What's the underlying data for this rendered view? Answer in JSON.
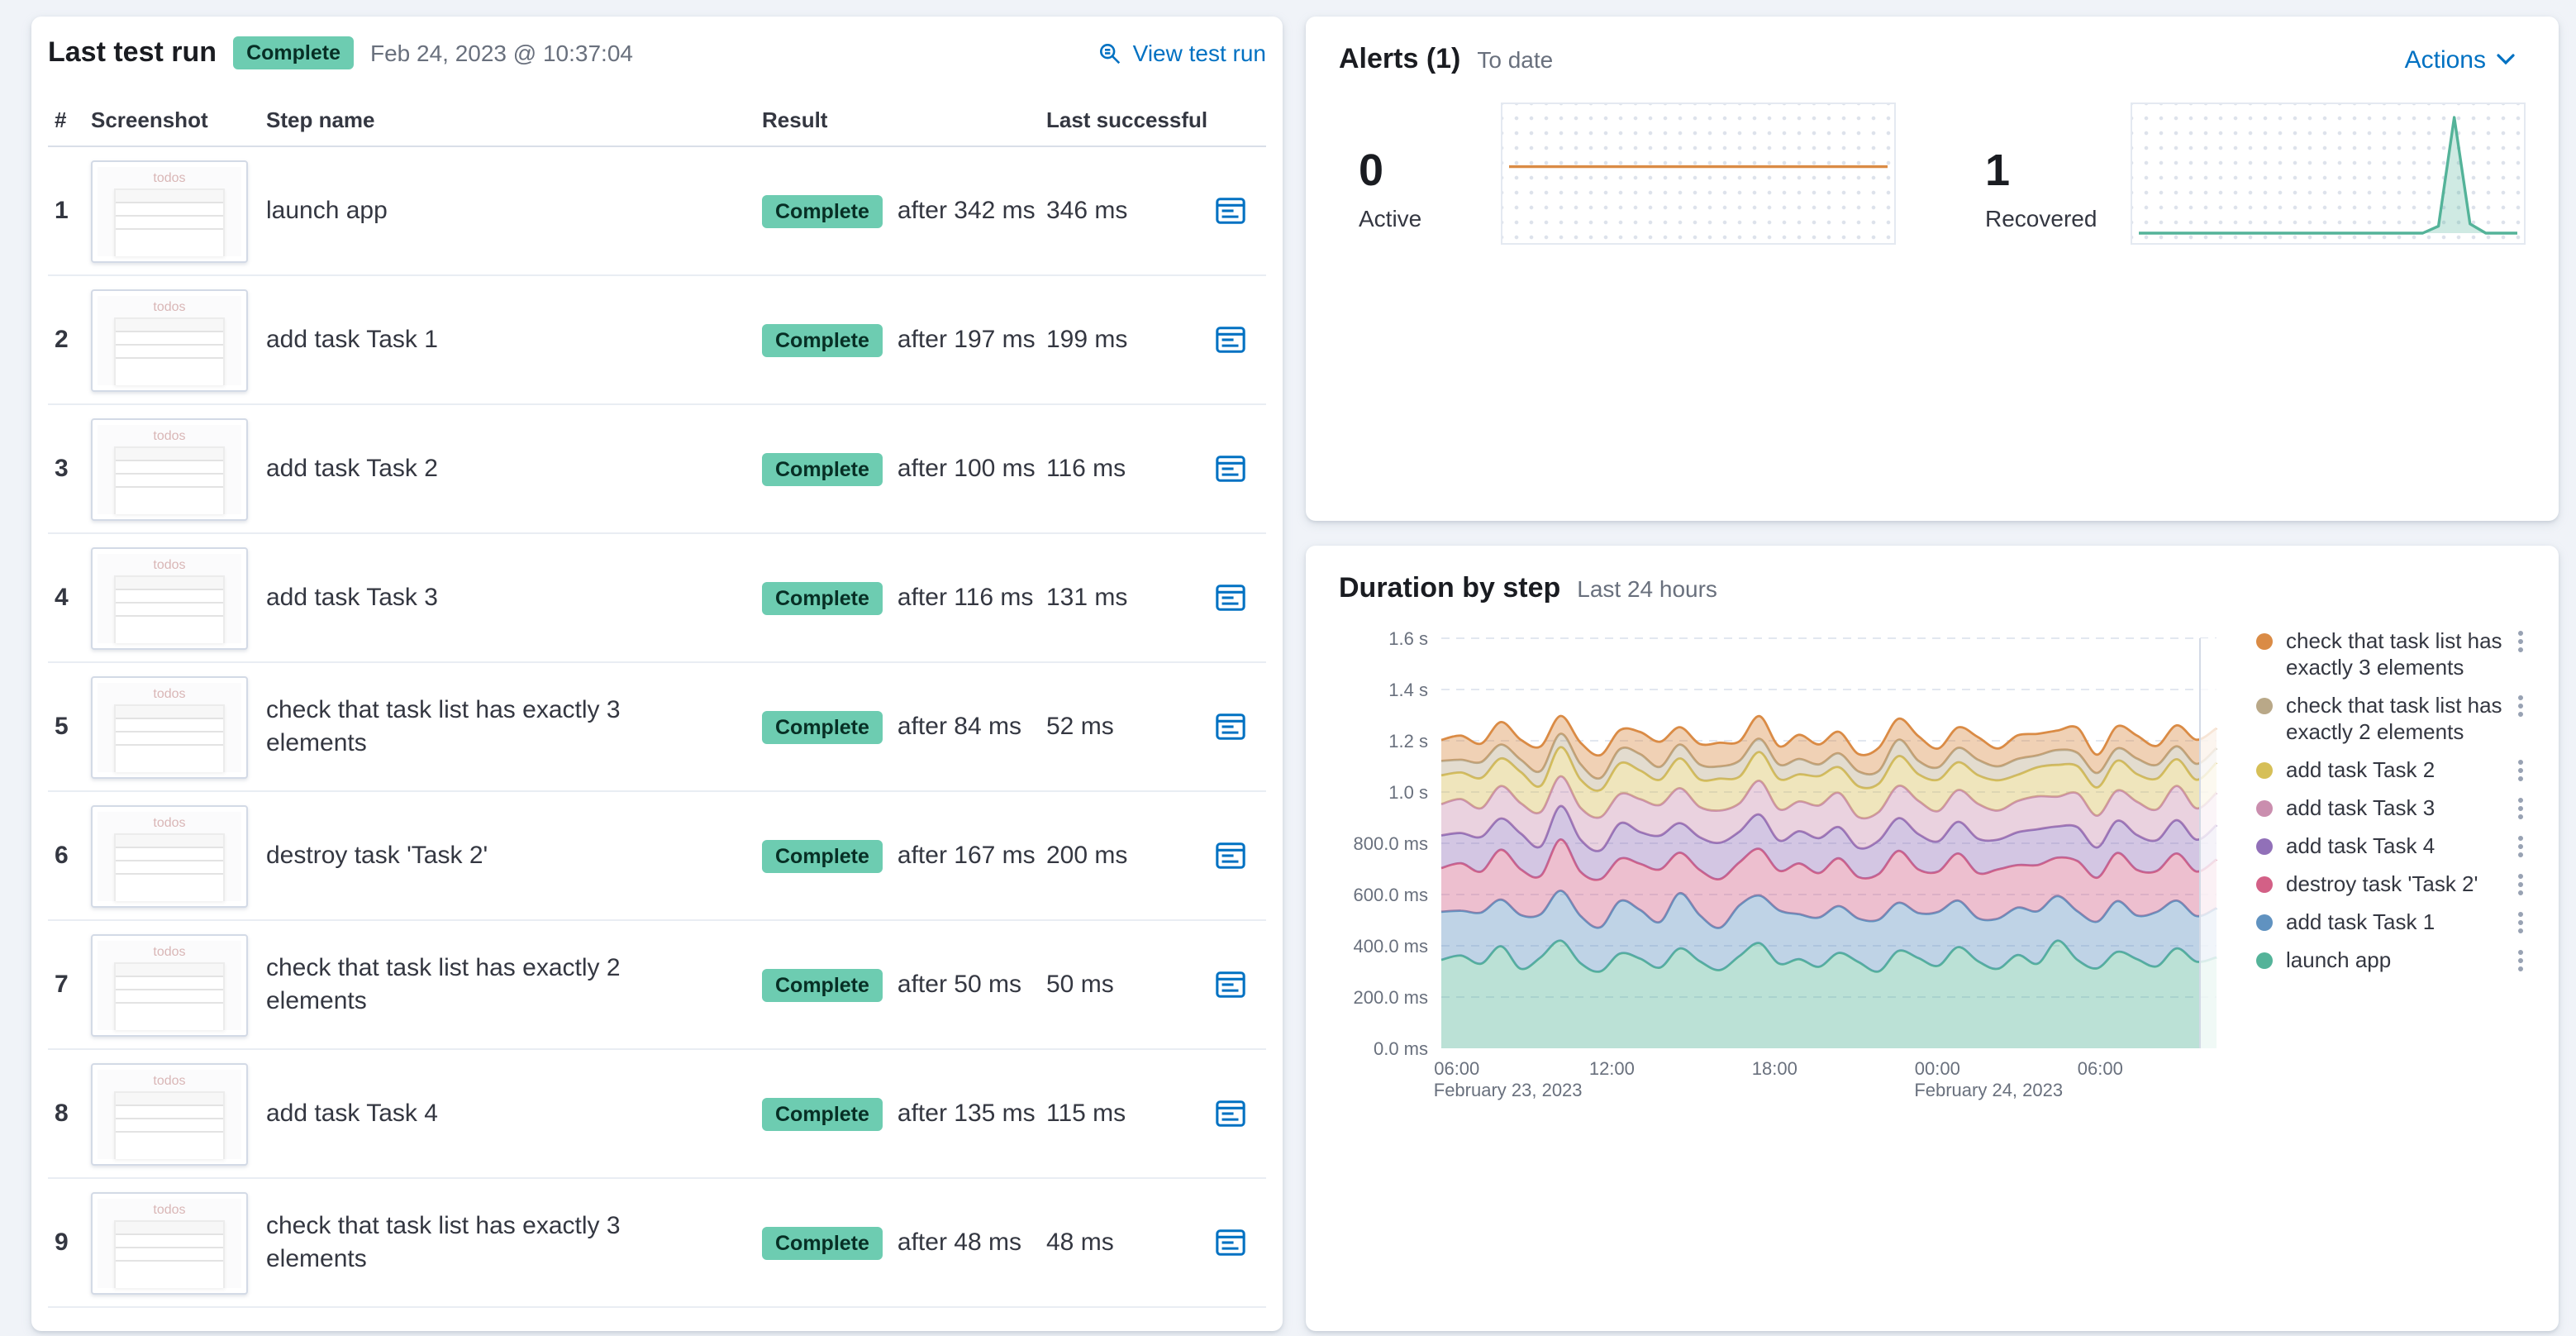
{
  "last_test_run": {
    "title": "Last test run",
    "status_badge": "Complete",
    "timestamp": "Feb 24, 2023 @ 10:37:04",
    "view_link": "View test run",
    "columns": [
      "#",
      "Screenshot",
      "Step name",
      "Result",
      "Last successful"
    ],
    "thumbnail_label": "todos",
    "steps": [
      {
        "num": "1",
        "name": "launch app",
        "result": "Complete",
        "after": "after 342 ms",
        "last": "346 ms"
      },
      {
        "num": "2",
        "name": "add task Task 1",
        "result": "Complete",
        "after": "after 197 ms",
        "last": "199 ms"
      },
      {
        "num": "3",
        "name": "add task Task 2",
        "result": "Complete",
        "after": "after 100 ms",
        "last": "116 ms"
      },
      {
        "num": "4",
        "name": "add task Task 3",
        "result": "Complete",
        "after": "after 116 ms",
        "last": "131 ms"
      },
      {
        "num": "5",
        "name": "check that task list has exactly 3 elements",
        "result": "Complete",
        "after": "after 84 ms",
        "last": "52 ms"
      },
      {
        "num": "6",
        "name": "destroy task 'Task 2'",
        "result": "Complete",
        "after": "after 167 ms",
        "last": "200 ms"
      },
      {
        "num": "7",
        "name": "check that task list has exactly 2 elements",
        "result": "Complete",
        "after": "after 50 ms",
        "last": "50 ms"
      },
      {
        "num": "8",
        "name": "add task Task 4",
        "result": "Complete",
        "after": "after 135 ms",
        "last": "115 ms"
      },
      {
        "num": "9",
        "name": "check that task list has exactly 3 elements",
        "result": "Complete",
        "after": "after 48 ms",
        "last": "48 ms"
      }
    ]
  },
  "alerts": {
    "title": "Alerts (1)",
    "subtitle": "To date",
    "actions_label": "Actions",
    "stats": [
      {
        "value": "0",
        "label": "Active"
      },
      {
        "value": "1",
        "label": "Recovered"
      }
    ]
  },
  "duration_panel": {
    "title": "Duration by step",
    "subtitle": "Last 24 hours"
  },
  "colors": {
    "page_bg": "#F0F3F8",
    "link": "#0071C2",
    "success_badge_bg": "#6DCCB1",
    "active_alert_line": "#DA8B45",
    "recovered_alert_line": "#54B399"
  },
  "chart_data": [
    {
      "type": "line",
      "name": "Active alerts sparkline",
      "color": "#DA8B45",
      "ylim": [
        0,
        1
      ],
      "flat_y_frac": 0.45,
      "values": [
        0,
        0,
        0,
        0,
        0,
        0,
        0,
        0,
        0,
        0,
        0,
        0,
        0,
        0,
        0,
        0,
        0,
        0,
        0,
        0,
        0,
        0,
        0,
        0,
        0
      ]
    },
    {
      "type": "area",
      "name": "Recovered alerts sparkline",
      "color": "#54B399",
      "fill": "rgba(84,179,153,0.28)",
      "ylim": [
        0,
        1
      ],
      "values": [
        0,
        0,
        0,
        0,
        0,
        0,
        0,
        0,
        0,
        0,
        0,
        0,
        0,
        0,
        0,
        0,
        0,
        0,
        0,
        0.06,
        1,
        0.08,
        0,
        0,
        0
      ]
    },
    {
      "type": "area",
      "stacked": true,
      "title": "Duration by step",
      "subtitle": "Last 24 hours",
      "ylabel": "",
      "xlabel": "",
      "ylim_ms": [
        0,
        1600
      ],
      "y_ticks": [
        "0.0 ms",
        "200.0 ms",
        "400.0 ms",
        "600.0 ms",
        "800.0 ms",
        "1.0 s",
        "1.2 s",
        "1.4 s",
        "1.6 s"
      ],
      "x_ticks": [
        {
          "label": "06:00",
          "frac": 0.02
        },
        {
          "label": "12:00",
          "frac": 0.22
        },
        {
          "label": "18:00",
          "frac": 0.43
        },
        {
          "label": "00:00",
          "frac": 0.64
        },
        {
          "label": "06:00",
          "frac": 0.85
        }
      ],
      "x_date_labels": [
        {
          "label": "February 23, 2023",
          "frac": 0.02
        },
        {
          "label": "February 24, 2023",
          "frac": 0.64
        }
      ],
      "series": [
        {
          "name": "launch app",
          "color": "#54B399",
          "values": [
            345,
            362,
            330,
            398,
            310,
            355,
            420,
            332,
            300,
            370,
            350,
            315,
            390,
            340,
            305,
            360,
            410,
            330,
            348,
            318,
            372,
            336,
            300,
            380,
            352,
            322,
            395,
            340,
            310,
            364,
            330,
            420,
            345,
            312,
            376,
            348,
            320,
            390,
            338,
            355
          ]
        },
        {
          "name": "add task Task 1",
          "color": "#6092C0",
          "values": [
            188,
            175,
            200,
            182,
            210,
            168,
            195,
            185,
            172,
            205,
            190,
            178,
            215,
            180,
            165,
            198,
            186,
            208,
            175,
            192,
            183,
            170,
            202,
            188,
            176,
            210,
            181,
            168,
            196,
            185,
            205,
            174,
            190,
            182,
            198,
            170,
            212,
            186,
            178,
            192
          ]
        },
        {
          "name": "destroy task 'Task 2'",
          "color": "#D36086",
          "values": [
            170,
            185,
            160,
            195,
            178,
            150,
            200,
            172,
            188,
            165,
            180,
            205,
            158,
            176,
            190,
            168,
            182,
            155,
            198,
            174,
            186,
            162,
            178,
            202,
            170,
            158,
            184,
            176,
            192,
            166,
            180,
            150,
            196,
            172,
            188,
            178,
            160,
            184,
            174,
            190
          ]
        },
        {
          "name": "add task Task 4",
          "color": "#9170B8",
          "values": [
            128,
            118,
            135,
            122,
            140,
            115,
            130,
            126,
            112,
            138,
            124,
            132,
            116,
            128,
            142,
            120,
            134,
            118,
            126,
            136,
            122,
            114,
            130,
            128,
            138,
            118,
            124,
            134,
            116,
            128,
            140,
            122,
            132,
            118,
            126,
            136,
            120,
            130,
            124,
            134
          ]
        },
        {
          "name": "add task Task 3",
          "color": "#CA8EAE",
          "values": [
            122,
            132,
            112,
            126,
            118,
            134,
            116,
            124,
            130,
            114,
            128,
            120,
            136,
            118,
            126,
            110,
            132,
            122,
            116,
            128,
            134,
            120,
            112,
            126,
            130,
            118,
            124,
            136,
            114,
            122,
            128,
            116,
            132,
            124,
            118,
            130,
            120,
            134,
            122,
            126
          ]
        },
        {
          "name": "add task Task 2",
          "color": "#D6BF57",
          "values": [
            112,
            104,
            118,
            108,
            122,
            102,
            114,
            110,
            106,
            120,
            112,
            98,
            116,
            108,
            124,
            104,
            112,
            118,
            106,
            114,
            100,
            120,
            110,
            116,
            104,
            122,
            108,
            112,
            118,
            102,
            114,
            124,
            106,
            110,
            116,
            108,
            120,
            104,
            112,
            118
          ]
        },
        {
          "name": "check that task list has exactly 2 elements",
          "color": "#B9A888",
          "values": [
            56,
            50,
            62,
            54,
            48,
            58,
            52,
            60,
            46,
            56,
            64,
            50,
            54,
            58,
            48,
            62,
            52,
            56,
            60,
            46,
            54,
            58,
            50,
            64,
            52,
            48,
            56,
            60,
            54,
            62,
            46,
            58,
            52,
            56,
            48,
            60,
            54,
            50,
            62,
            56
          ]
        },
        {
          "name": "check that task list has exactly 3 elements",
          "color": "#DA8B45",
          "values": [
            82,
            94,
            72,
            88,
            78,
            96,
            70,
            84,
            90,
            74,
            86,
            98,
            68,
            80,
            92,
            76,
            88,
            72,
            94,
            78,
            84,
            68,
            90,
            82,
            96,
            74,
            80,
            88,
            70,
            92,
            84,
            76,
            98,
            72,
            86,
            90,
            74,
            82,
            94,
            78
          ]
        }
      ]
    }
  ]
}
